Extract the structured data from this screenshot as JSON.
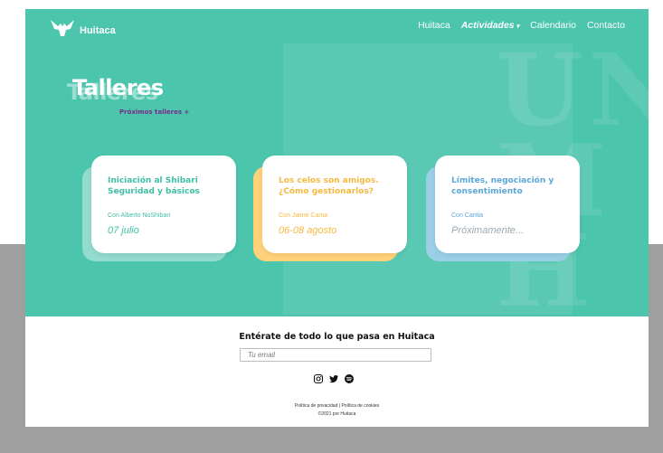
{
  "brand": {
    "name": "Huitaca"
  },
  "nav": {
    "items": [
      {
        "label": "Huitaca"
      },
      {
        "label": "Actividades"
      },
      {
        "label": "Calendario"
      },
      {
        "label": "Contacto"
      }
    ],
    "caret": "▾"
  },
  "hero": {
    "title": "Talleres",
    "title_shadow": "Talleres",
    "subtitle": "Próximos talleres +",
    "background_text": "UN\nM\nH"
  },
  "cards": [
    {
      "title": "Iniciación al Shibari Seguridad y básicos",
      "author": "Con Alberto NoShibari",
      "date": "07 julio",
      "accent": "#3fbfa5",
      "shadow": "#ffffff"
    },
    {
      "title": "Los celos son amigos. ¿Cómo gestionarlos?",
      "author": "Con Jaime Cama",
      "date": "06-08 agosto",
      "accent": "#f4b942",
      "shadow": "#ffd27a"
    },
    {
      "title": "Límites, negociación y consentimiento",
      "author": "Con Caritia",
      "date": "Próximamente...",
      "accent": "#5aa7d8",
      "shadow": "#9ad0e6"
    }
  ],
  "footer": {
    "newsletter_title": "Entérate de todo lo que pasa en Huitaca",
    "email_placeholder": "Tu email",
    "social": [
      "instagram-icon",
      "twitter-icon",
      "spotify-icon"
    ],
    "privacy": "Política de privacidad",
    "separator": "|",
    "cookies": "Política de cookies",
    "copyright": "©2021 por Huitaca"
  },
  "colors": {
    "hero_bg": "#4cc5ad",
    "subtitle": "#7a2a8a",
    "page_gray": "#9f9f9f"
  }
}
